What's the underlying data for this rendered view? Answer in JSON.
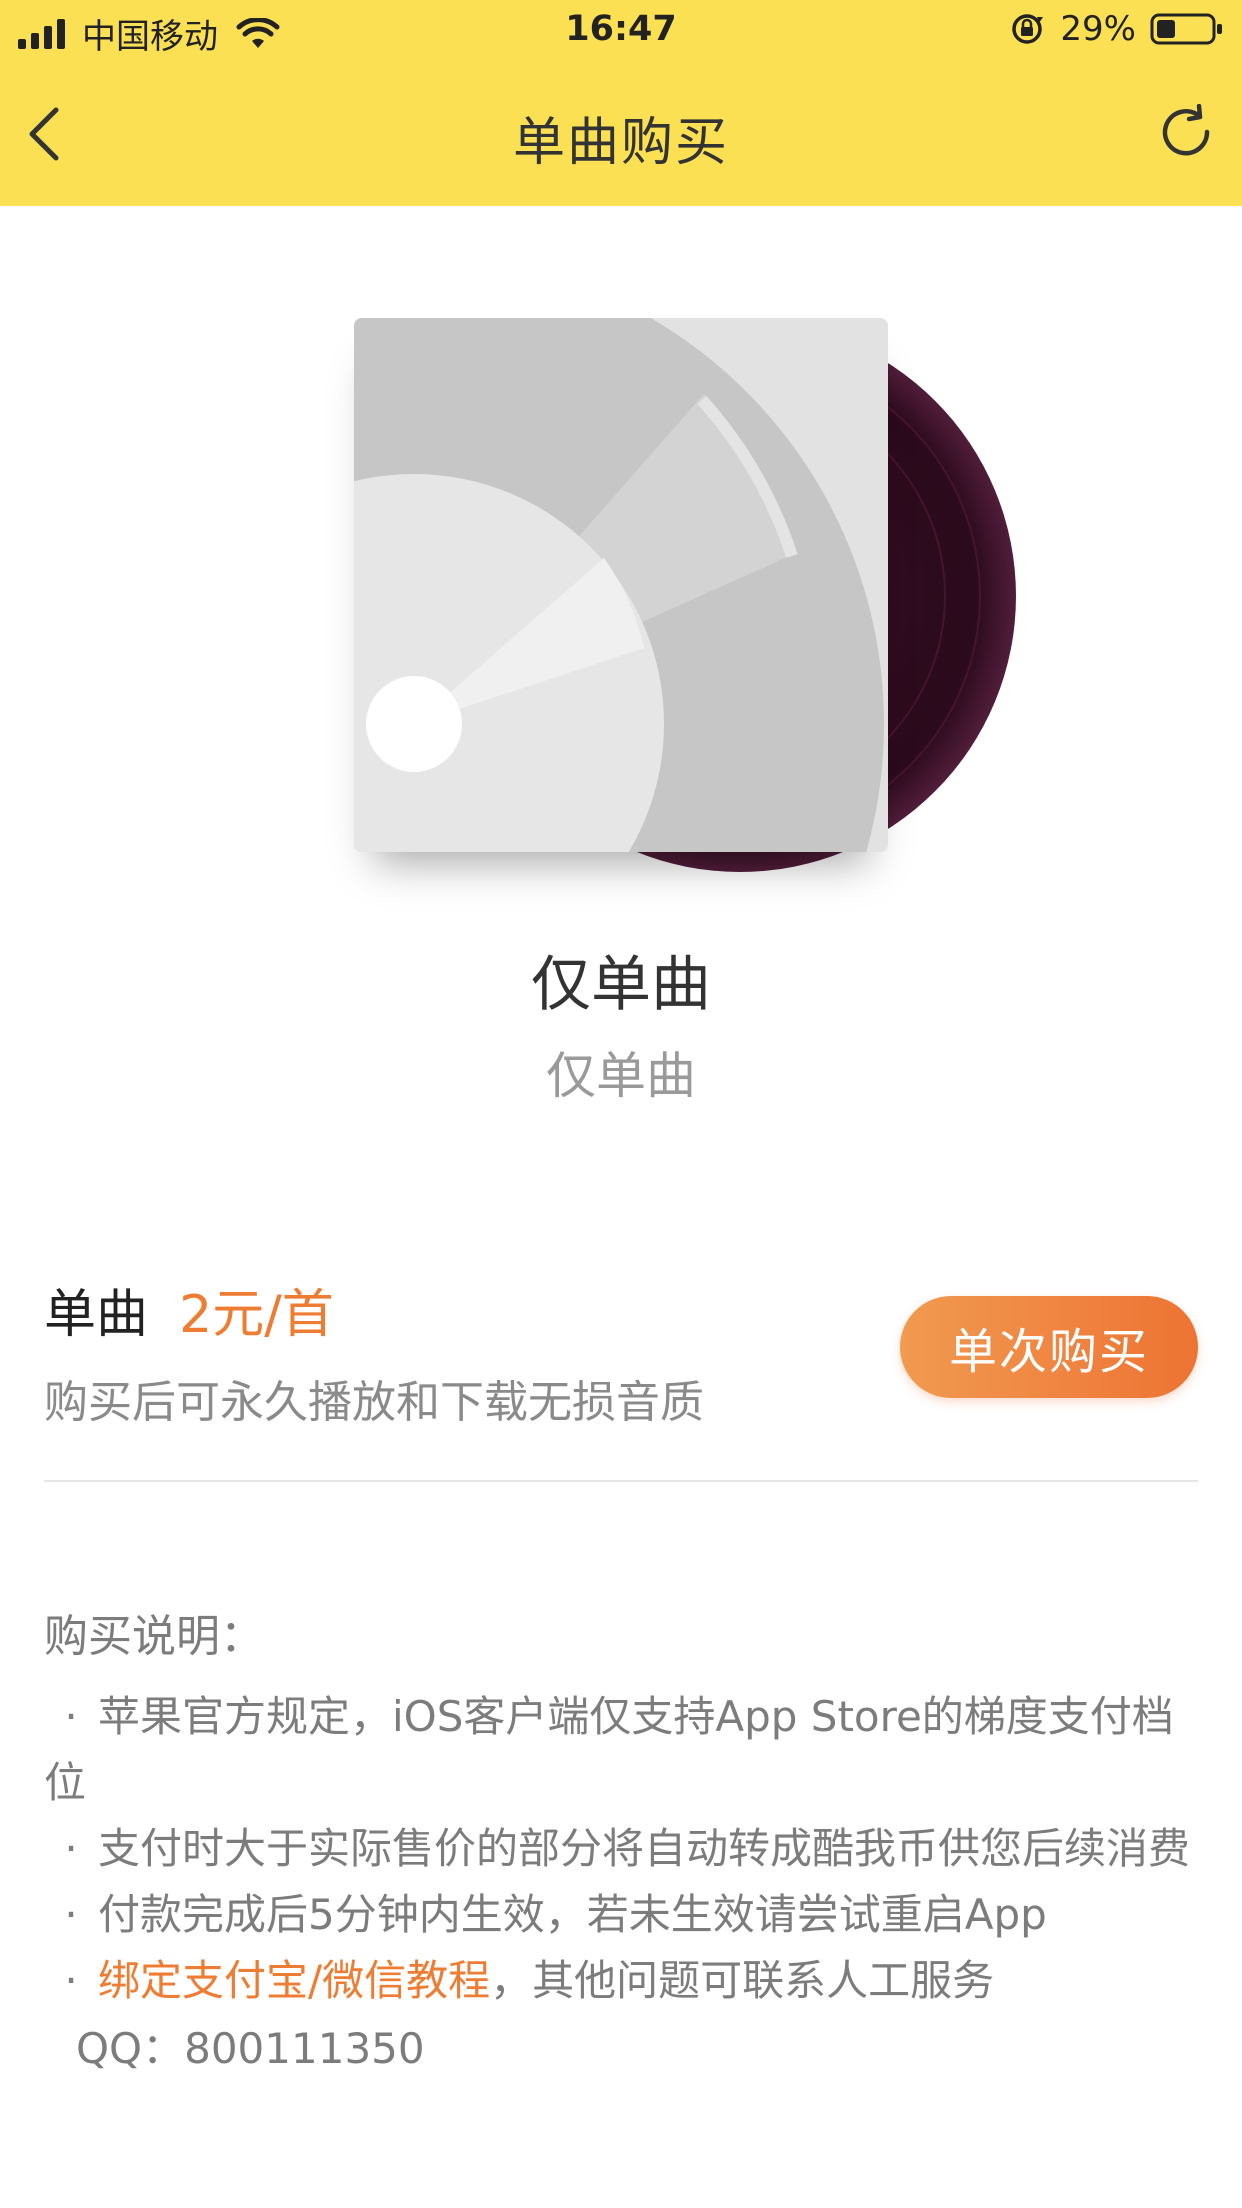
{
  "status_bar": {
    "carrier": "中国移动",
    "time": "16:47",
    "battery_percent": "29%",
    "battery_level": 0.29
  },
  "nav": {
    "title": "单曲购买",
    "back_icon": "chevron-left-icon",
    "refresh_icon": "refresh-icon"
  },
  "song": {
    "title": "仅单曲",
    "artist": "仅单曲"
  },
  "purchase": {
    "label": "单曲",
    "price": "2元/首",
    "description": "购买后可永久播放和下载无损音质",
    "button_label": "单次购买",
    "accent_color": "#ee7d33"
  },
  "notes": {
    "title": "购买说明：",
    "bullet": "·",
    "items": [
      "苹果官方规定，iOS客户端仅支持App Store的梯度支付档",
      "位",
      "支付时大于实际售价的部分将自动转成酷我币供您后续消费",
      "付款完成后5分钟内生效，若未生效请尝试重启App"
    ],
    "link_text": "绑定支付宝/微信教程",
    "link_suffix": "，其他问题可联系人工服务",
    "qq": "QQ：800111350"
  },
  "colors": {
    "header_bg": "#fae052",
    "button_gradient_start": "#f19a50",
    "button_gradient_end": "#ee7333"
  }
}
